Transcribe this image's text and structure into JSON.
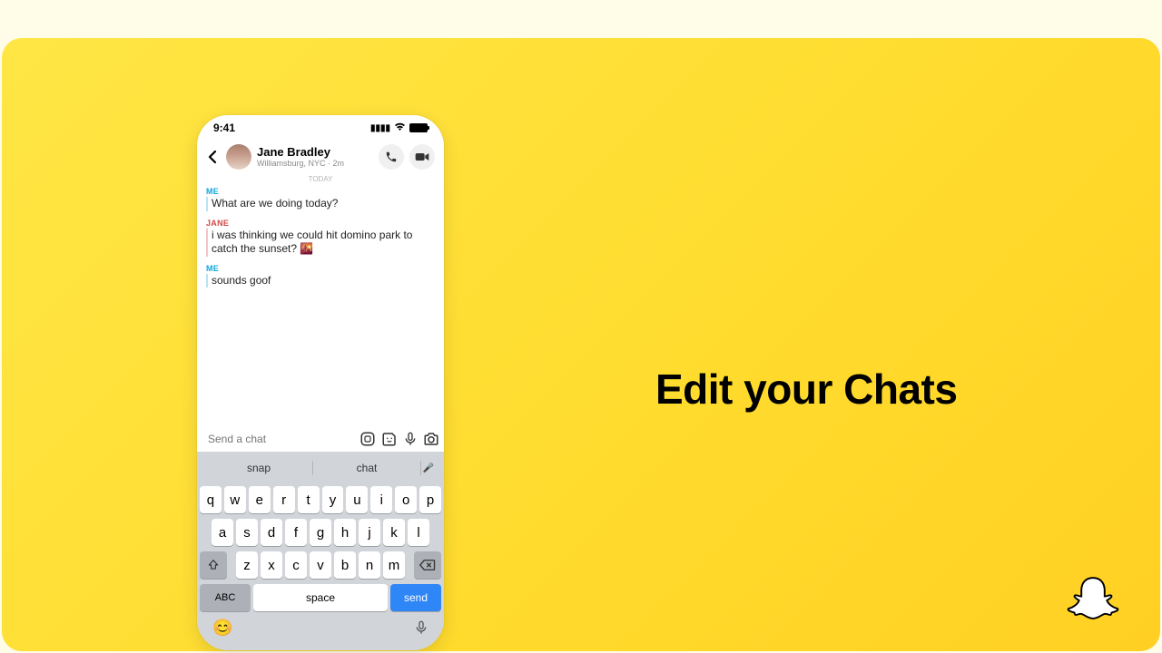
{
  "status": {
    "time": "9:41"
  },
  "header": {
    "name": "Jane Bradley",
    "subtitle": "Williamsburg, NYC · 2m",
    "today": "TODAY"
  },
  "messages": [
    {
      "sender": "ME",
      "senderClass": "me",
      "body": "What are we doing today?"
    },
    {
      "sender": "JANE",
      "senderClass": "jane",
      "body": "i was thinking we could hit domino park to catch the sunset? 🌇"
    },
    {
      "sender": "ME",
      "senderClass": "me",
      "body": "sounds goof"
    }
  ],
  "input": {
    "placeholder": "Send a chat"
  },
  "keyboard": {
    "suggestions": [
      "snap",
      "chat"
    ],
    "row1": [
      "q",
      "w",
      "e",
      "r",
      "t",
      "y",
      "u",
      "i",
      "o",
      "p"
    ],
    "row2": [
      "a",
      "s",
      "d",
      "f",
      "g",
      "h",
      "j",
      "k",
      "l"
    ],
    "row3": [
      "z",
      "x",
      "c",
      "v",
      "b",
      "n",
      "m"
    ],
    "abc": "ABC",
    "space": "space",
    "send": "send"
  },
  "headline": "Edit your Chats"
}
